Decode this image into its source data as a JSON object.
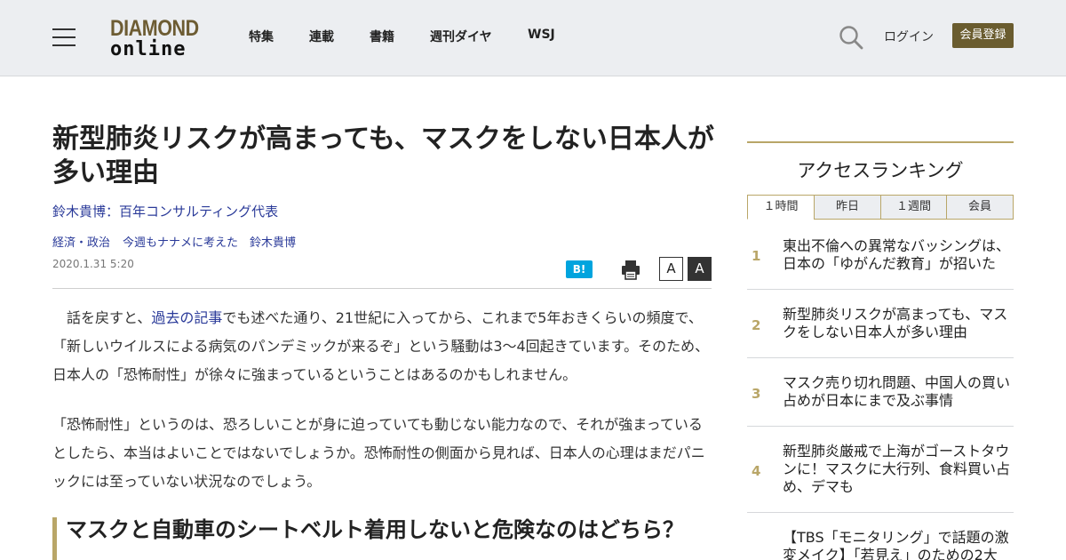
{
  "header": {
    "logo_line1": "DIAMOND",
    "logo_line2": "online",
    "nav": [
      "特集",
      "連載",
      "書籍",
      "週刊ダイヤ",
      "WSJ"
    ],
    "login_label": "ログイン",
    "register_label": "会員登録"
  },
  "article": {
    "title": "新型肺炎リスクが高まっても、マスクをしない日本人が多い理由",
    "author": "鈴木貴博：百年コンサルティング代表",
    "tags": [
      "経済・政治",
      "今週もナナメに考えた",
      "鈴木貴博"
    ],
    "date": "2020.1.31 5:20",
    "hatena_label": "B!",
    "font_small_label": "A",
    "font_large_label": "A",
    "p1_prefix": "　話を戻すと、",
    "p1_link": "過去の記事",
    "p1_rest": "でも述べた通り、21世紀に入ってから、これまで5年おきくらいの頻度で、「新しいウイルスによる病気のパンデミックが来るぞ」という騒動は3～4回起きています。そのため、日本人の「恐怖耐性」が徐々に強まっているということはあるのかもしれません。",
    "p2": "「恐怖耐性」というのは、恐ろしいことが身に迫っていても動じない能力なので、それが強まっているとしたら、本当はよいことではないでしょうか。恐怖耐性の側面から見れば、日本人の心理はまだパニックには至っていない状況なのでしょう。",
    "subhead": "マスクと自動車のシートベルト着用しないと危険なのはどちら？"
  },
  "ranking": {
    "title": "アクセスランキング",
    "tabs": [
      "１時間",
      "昨日",
      "１週間",
      "会員"
    ],
    "active_tab": 0,
    "items": [
      {
        "num": "1",
        "text": "東出不倫への異常なバッシングは、日本の「ゆがんだ教育」が招いた"
      },
      {
        "num": "2",
        "text": "新型肺炎リスクが高まっても、マスクをしない日本人が多い理由"
      },
      {
        "num": "3",
        "text": "マスク売り切れ問題、中国人の買い占めが日本にまで及ぶ事情"
      },
      {
        "num": "4",
        "text": "新型肺炎厳戒で上海がゴーストタウンに！マスクに大行列、食料買い占め、デマも"
      },
      {
        "num": "",
        "text": "【TBS「モニタリング」で話題の激変メイク】「若見え」のための2大"
      }
    ]
  },
  "colors": {
    "accent_gold": "#b9a668",
    "register_bg": "#6a5c2f",
    "link_blue": "#2a3a99",
    "hatena_blue": "#00a4de",
    "header_bg": "#eceef1"
  }
}
